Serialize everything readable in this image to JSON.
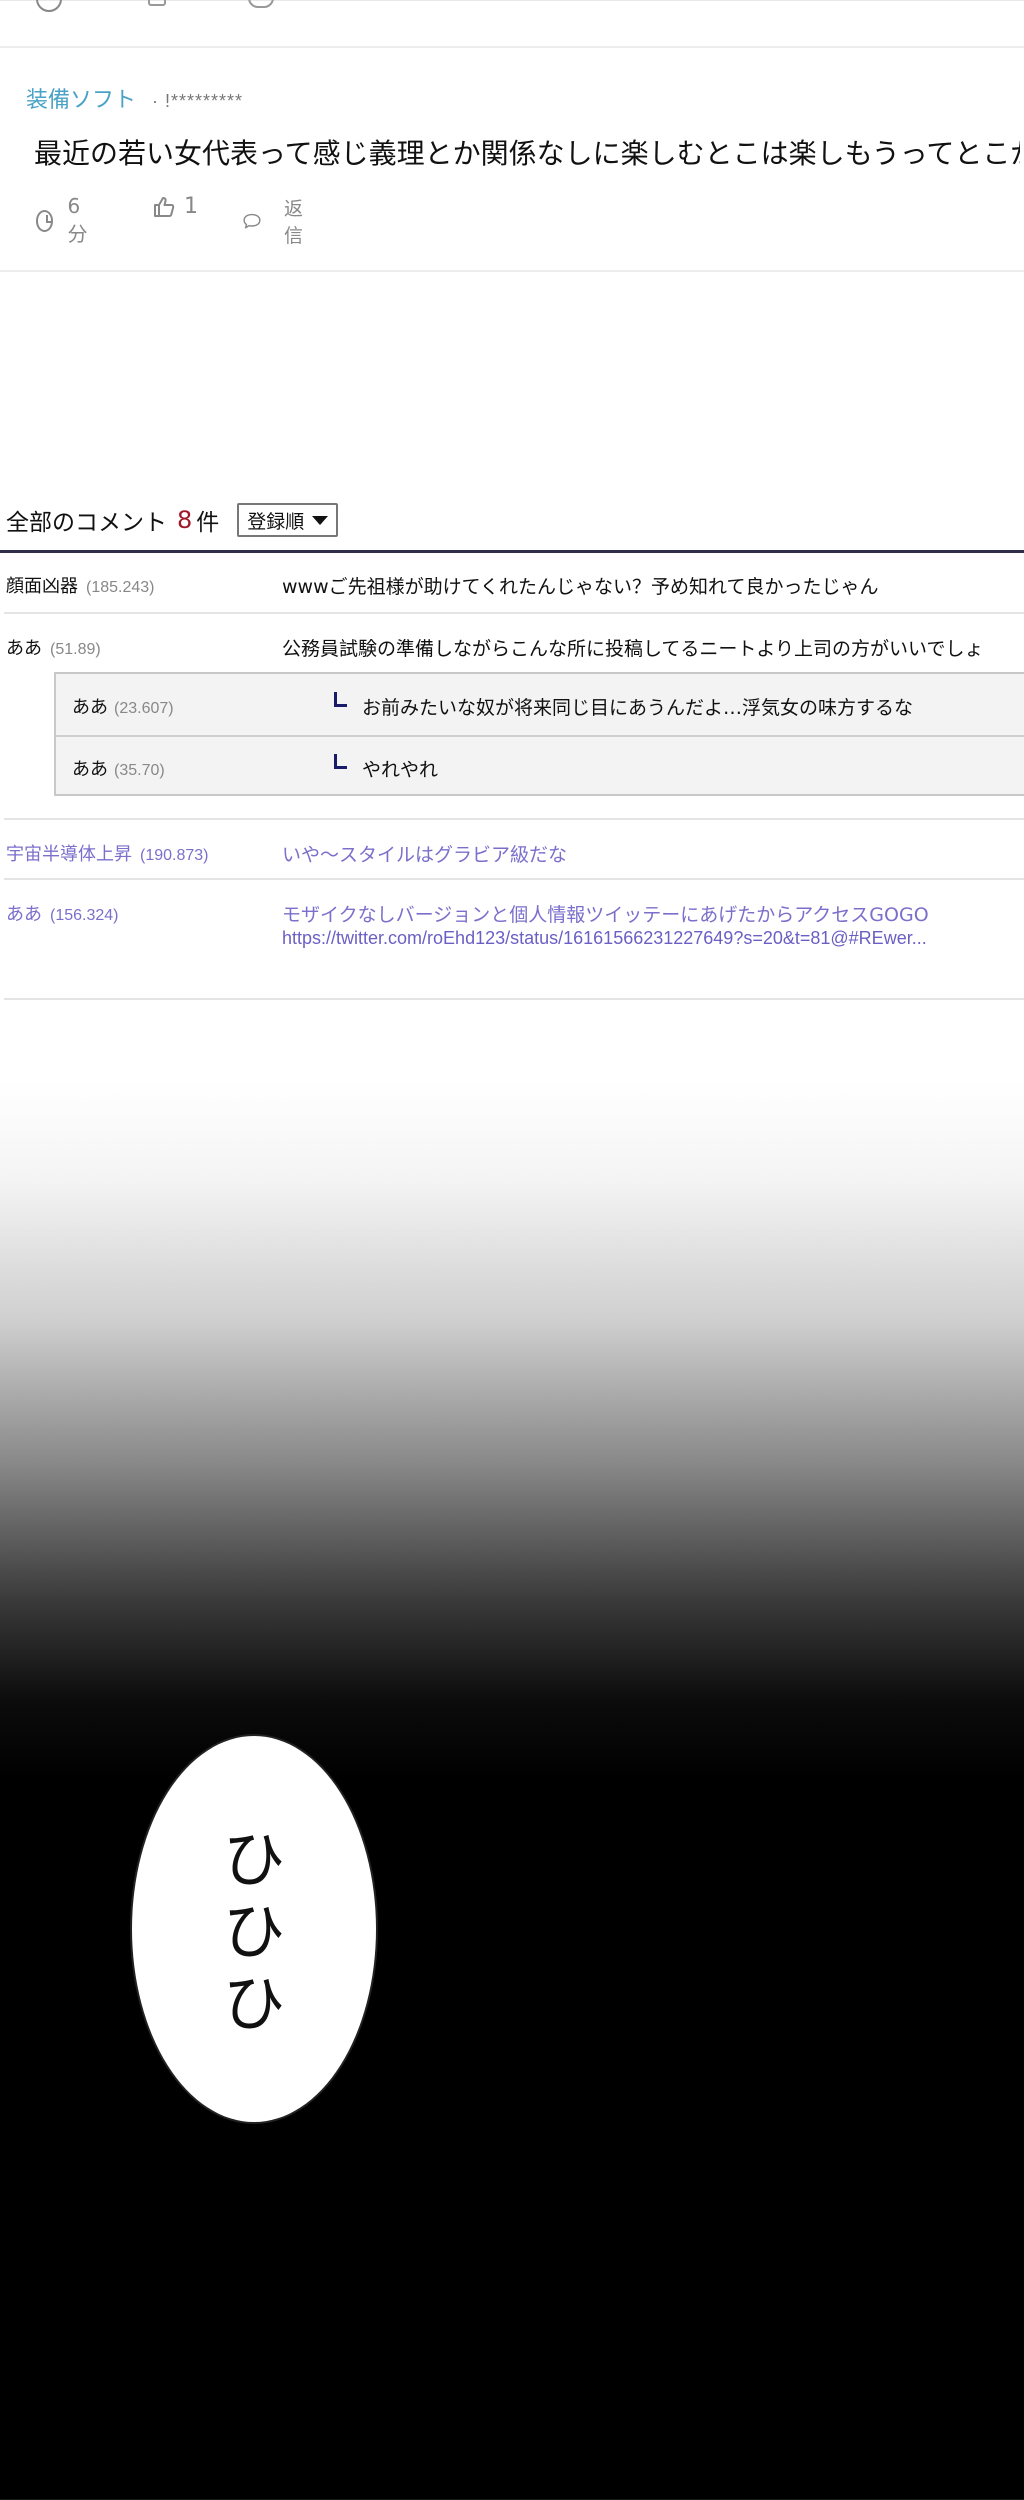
{
  "featured_comment": {
    "author": "装備ソフト",
    "masked_id": "· !*********",
    "text": "最近の若い女代表って感じ義理とか関係なしに楽しむとこは楽しもうってとこが",
    "time": "6分",
    "likes": "1",
    "reply_label": "返信"
  },
  "comment_list": {
    "title": "全部のコメント",
    "count": "8",
    "unit": "件",
    "sort_selected": "登録順",
    "rows": [
      {
        "name": "顔面凶器",
        "score": "(185.243)",
        "text": "wwwご先祖様が助けてくれたんじゃない？予め知れて良かったじゃん"
      },
      {
        "name": "ああ",
        "score": "(51.89)",
        "text": "公務員試験の準備しながらこんな所に投稿してるニートより上司の方がいいでしょ"
      }
    ],
    "replies": [
      {
        "name": "ああ",
        "score": "(23.607)",
        "text": "お前みたいな奴が将来同じ目にあうんだよ…浮気女の味方するな"
      },
      {
        "name": "ああ",
        "score": "(35.70)",
        "text": "やれやれ"
      }
    ],
    "visited_rows": [
      {
        "name": "宇宙半導体上昇",
        "score": "(190.873)",
        "text": "いや〜スタイルはグラビア級だな"
      },
      {
        "name": "ああ",
        "score": "(156.324)",
        "text": "モザイクなしバージョンと個人情報ツイッテーにあげたからアクセスGOGO"
      }
    ],
    "link_url": "https://twitter.com/roEhd123/status/16161566231227649?s=20&t=81@#REwer..."
  },
  "speech_bubble": {
    "chars": [
      "ひ",
      "ひ",
      "ひ"
    ]
  },
  "colors": {
    "author_blue": "#4aa3c6",
    "count_red": "#a0182a",
    "visited_purple": "#7b6fcb",
    "rule_navy": "#2e2e4a"
  }
}
